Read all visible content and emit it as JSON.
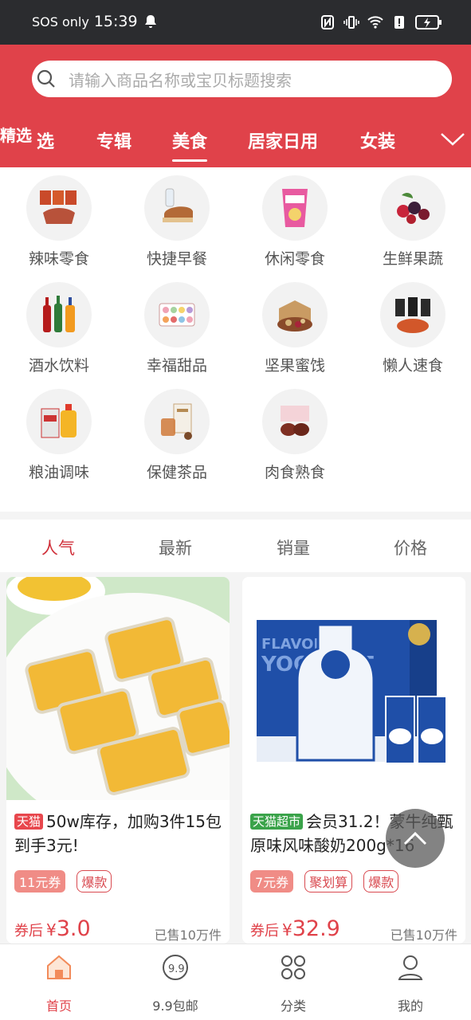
{
  "status": {
    "carrier": "SOS only",
    "time": "15:39"
  },
  "search": {
    "placeholder": "请输入商品名称或宝贝标题搜索"
  },
  "tabs": {
    "first_a": "精选",
    "first_b": "选",
    "t1": "专辑",
    "t2": "美食",
    "t3": "居家日用",
    "t4": "女装",
    "t5": ""
  },
  "categories": [
    {
      "label": "辣味零食"
    },
    {
      "label": "快捷早餐"
    },
    {
      "label": "休闲零食"
    },
    {
      "label": "生鲜果蔬"
    },
    {
      "label": "酒水饮料"
    },
    {
      "label": "幸福甜品"
    },
    {
      "label": "坚果蜜饯"
    },
    {
      "label": "懒人速食"
    },
    {
      "label": "粮油调味"
    },
    {
      "label": "保健茶品"
    },
    {
      "label": "肉食熟食"
    }
  ],
  "sort": {
    "a": "人气",
    "b": "最新",
    "c": "销量",
    "d": "价格"
  },
  "products": [
    {
      "shop": "天猫",
      "shop_color": "#e8474d",
      "title": "50w库存，加购3件15包到手3元!",
      "coupon": "11元券",
      "tag1": "爆款",
      "price_prefix": "券后",
      "yen": "¥",
      "price": "3.0",
      "sold": "已售10万件"
    },
    {
      "shop": "天猫超市",
      "shop_color": "#3aa34a",
      "title": "会员31.2！蒙牛纯甄原味风味酸奶200g*16",
      "coupon": "7元券",
      "tag1": "聚划算",
      "tag2": "爆款",
      "price_prefix": "券后",
      "yen": "¥",
      "price": "32.9",
      "sold": "已售10万件"
    }
  ],
  "tabbar": {
    "home": "首页",
    "nine": "9.9包邮",
    "cat": "分类",
    "me": "我的"
  },
  "colors": {
    "accent": "#e0424a"
  }
}
